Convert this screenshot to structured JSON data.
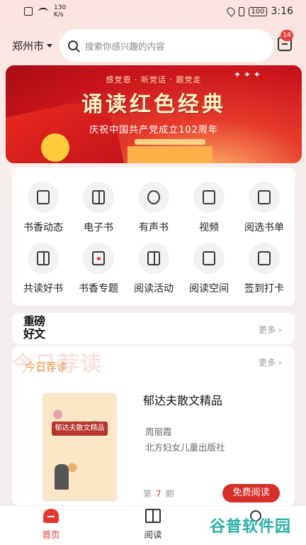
{
  "status_bar": {
    "speed_value": "130",
    "speed_unit": "K/s",
    "battery": "100",
    "time": "3:16"
  },
  "header": {
    "city": "郑州市",
    "search_placeholder": "搜索你感兴趣的内容",
    "message_badge": "14"
  },
  "banner": {
    "top_line": "感党恩 · 听党话 · 跟党走",
    "title": "诵读红色经典",
    "subtitle": "庆祝中国共产党成立102周年"
  },
  "features": [
    {
      "label": "书香动态",
      "icon": "news-icon"
    },
    {
      "label": "电子书",
      "icon": "ebook-icon"
    },
    {
      "label": "有声书",
      "icon": "headphones-icon"
    },
    {
      "label": "视频",
      "icon": "video-icon"
    },
    {
      "label": "阅选书单",
      "icon": "booklist-icon"
    },
    {
      "label": "共读好书",
      "icon": "open-book-icon"
    },
    {
      "label": "书香专题",
      "icon": "topic-icon"
    },
    {
      "label": "阅读活动",
      "icon": "activity-icon"
    },
    {
      "label": "阅读空间",
      "icon": "layers-icon"
    },
    {
      "label": "签到打卡",
      "icon": "calendar-check-icon"
    }
  ],
  "featured_section": {
    "logo_line1": "重磅",
    "logo_line2": "好文",
    "more": "更多"
  },
  "daily_pick": {
    "watermark": "今日荐读",
    "title": "今日荐读",
    "more": "更多",
    "book": {
      "title": "郁达夫散文精品",
      "author": "周丽霞",
      "publisher": "北方妇女儿童出版社",
      "cover_label": "郁达夫散文精品",
      "issue_prefix": "第",
      "issue_number": "7",
      "issue_suffix": "期",
      "button": "免费阅读"
    }
  },
  "tabbar": {
    "home": "首页",
    "read": "阅读"
  },
  "watermark_overlay": "谷普软件园",
  "colors": {
    "accent": "#e23a33",
    "banner_red": "#c8141a",
    "gold": "#e0a050"
  }
}
